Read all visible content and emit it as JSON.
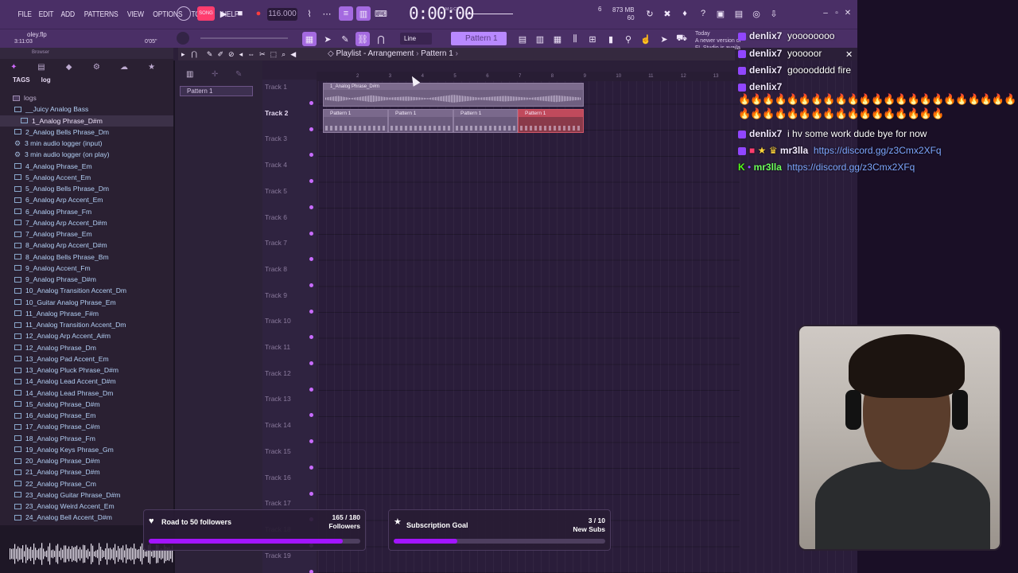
{
  "menu": [
    "FILE",
    "EDIT",
    "ADD",
    "PATTERNS",
    "VIEW",
    "OPTIONS",
    "TOOLS",
    "HELP"
  ],
  "transport": {
    "tempo": "116.000",
    "time": "0:00:00",
    "time_unit": "M:S:CS",
    "memory": "873 MB",
    "cpu": "60",
    "voices": "6"
  },
  "project": {
    "name": "oley.flp",
    "time": "3:11:03",
    "length": "0'05\""
  },
  "snap_mode": "Line",
  "pattern_selector": "Pattern 1",
  "news": {
    "line1": "Today",
    "line2": "A newer version of",
    "line3": "FL Studio is availa"
  },
  "browser": {
    "title": "Browser",
    "tags_label": "TAGS",
    "log_label": "log",
    "folder": "logs",
    "files": [
      "__Juicy Analog Bass",
      "1_Analog Phrase_D#m",
      "2_Analog Bells Phrase_Dm",
      "3 min audio logger (input)",
      "3 min audio logger (on play)",
      "4_Analog Phrase_Em",
      "5_Analog Accent_Em",
      "5_Analog Bells Phrase_Dm",
      "6_Analog Arp Accent_Em",
      "6_Analog Phrase_Fm",
      "7_Analog Arp Accent_D#m",
      "7_Analog Phrase_Em",
      "8_Analog Arp Accent_D#m",
      "8_Analog Bells Phrase_Bm",
      "9_Analog Accent_Fm",
      "9_Analog Phrase_D#m",
      "10_Analog Transition Accent_Dm",
      "10_Guitar Analog Phrase_Em",
      "11_Analog Phrase_F#m",
      "11_Analog Transition Accent_Dm",
      "12_Analog Arp Accent_A#m",
      "12_Analog Phrase_Dm",
      "13_Analog Pad Accent_Em",
      "13_Analog Pluck Phrase_D#m",
      "14_Analog Lead Accent_D#m",
      "14_Analog Lead Phrase_Dm",
      "15_Analog  Phrase_D#m",
      "16_Analog  Phrase_Em",
      "17_Analog  Phrase_C#m",
      "18_Analog  Phrase_Fm",
      "19_Analog Keys Phrase_Gm",
      "20_Analog Phrase_D#m",
      "21_Analog Phrase_D#m",
      "22_Analog Phrase_Cm",
      "23_Analog Guitar Phrase_D#m",
      "23_Analog Weird Accent_Em",
      "24_Analog Bell Accent_D#m"
    ]
  },
  "pattern_list": [
    "Pattern 1"
  ],
  "playlist": {
    "title": "Playlist - Arrangement",
    "breadcrumb": "Pattern 1",
    "tracks": [
      "Track 1",
      "Track 2",
      "Track 3",
      "Track 4",
      "Track 5",
      "Track 6",
      "Track 7",
      "Track 8",
      "Track 9",
      "Track 10",
      "Track 11",
      "Track 12",
      "Track 13",
      "Track 14",
      "Track 15",
      "Track 16",
      "Track 17",
      "Track 18",
      "Track 19"
    ],
    "ruler": [
      "2",
      "3",
      "4",
      "5",
      "6",
      "7",
      "8",
      "9",
      "10",
      "11",
      "12",
      "13"
    ],
    "audio_clip": "1_Analog Phrase_D#m",
    "pattern_clips": [
      "Pattern 1",
      "Pattern 1",
      "Pattern 1",
      "Pattern 1"
    ]
  },
  "chat": [
    {
      "user": "denlix7",
      "msg": "yoooooooo"
    },
    {
      "user": "denlix7",
      "msg": "yooooor"
    },
    {
      "user": "denlix7",
      "msg": "goooodddd fire"
    },
    {
      "user": "denlix7",
      "msg": "🔥🔥🔥🔥🔥🔥🔥🔥🔥🔥🔥🔥🔥🔥🔥🔥🔥🔥🔥🔥🔥🔥🔥🔥🔥🔥🔥🔥🔥🔥🔥🔥🔥🔥🔥🔥🔥🔥🔥🔥"
    },
    {
      "user": "denlix7",
      "msg": "i hv some work dude bye for now"
    },
    {
      "user": "mr3lla",
      "msg": "https://discord.gg/z3Cmx2XFq"
    },
    {
      "user": "mr3lla",
      "msg": "https://discord.gg/z3Cmx2XFq"
    }
  ],
  "goals": {
    "followers": {
      "title": "Road to 50 followers",
      "count": "165 / 180",
      "unit": "Followers",
      "progress": 0.917
    },
    "subs": {
      "title": "Subscription Goal",
      "count": "3 / 10",
      "unit": "New Subs",
      "progress": 0.3
    }
  },
  "colors": {
    "accent": "#c86bff",
    "goal_fill": "#a214ff",
    "toolbar": "#4a2f66",
    "selected_clip": "#c04a5c"
  }
}
